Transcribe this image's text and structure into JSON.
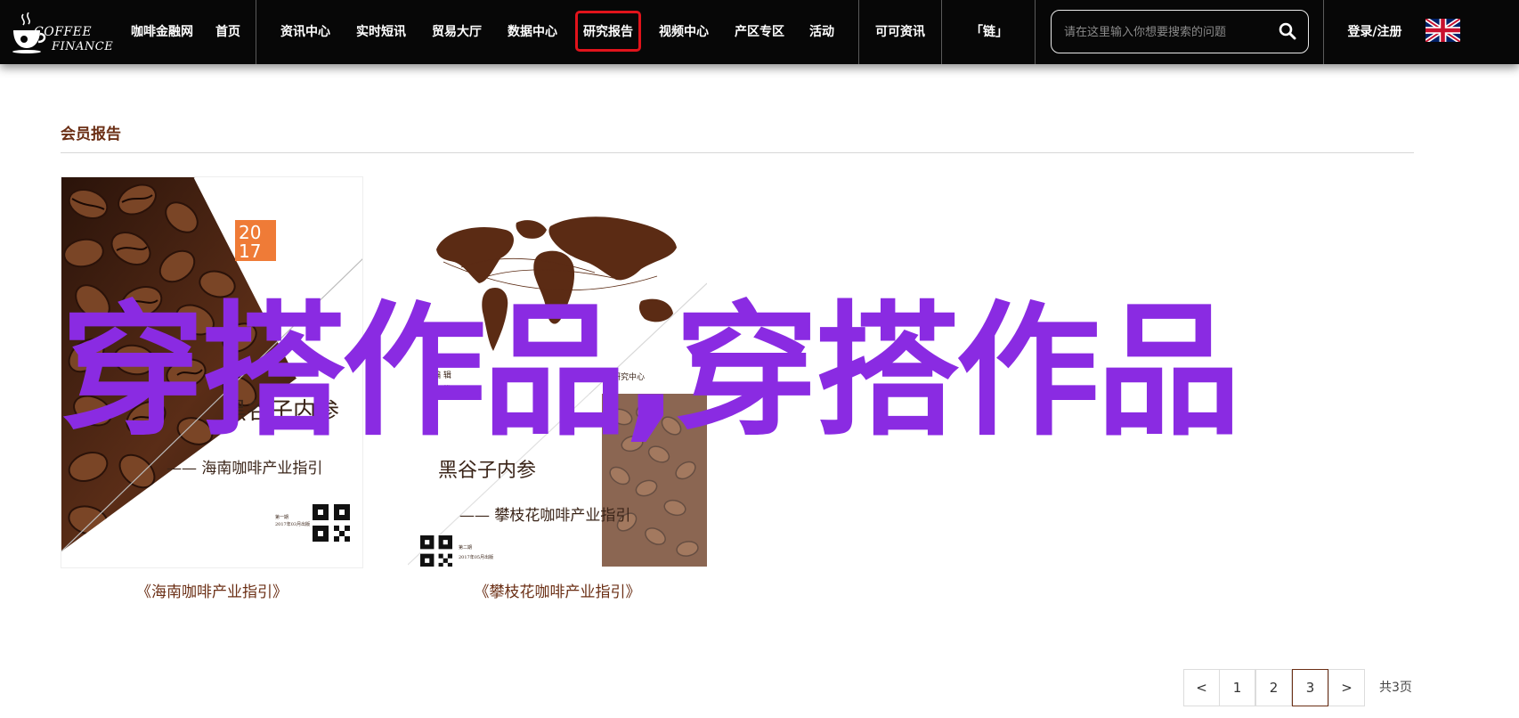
{
  "header": {
    "logo": {
      "line1": "COFFEE",
      "line2": "FINANCE"
    },
    "nav": [
      {
        "label": "咖啡金融网"
      },
      {
        "label": "首页"
      },
      {
        "label": "资讯中心"
      },
      {
        "label": "实时短讯"
      },
      {
        "label": "贸易大厅"
      },
      {
        "label": "数据中心"
      },
      {
        "label": "研究报告",
        "active": true
      },
      {
        "label": "视频中心"
      },
      {
        "label": "产区专区"
      },
      {
        "label": "活动"
      },
      {
        "label": "可可资讯"
      },
      {
        "label": "「链」"
      }
    ],
    "search": {
      "placeholder": "请在这里输入你想要搜索的问题"
    },
    "login_label": "登录/注册",
    "accent_color": "#e1131b"
  },
  "section": {
    "title": "会员报告"
  },
  "reports": [
    {
      "caption": "《海南咖啡产业指引》",
      "cover": {
        "year_top": "20",
        "year_bottom": "17",
        "title": "黑谷子内参",
        "subtitle": "—— 海南咖啡产业指引",
        "qr_note1": "第一期",
        "qr_note2": "2017年03月出版"
      }
    },
    {
      "caption": "《攀枝花咖啡产业指引》",
      "cover": {
        "line_a": "编  辑",
        "line_b": "海  拔",
        "line_c": "全球咖啡产业研究中心",
        "title": "黑谷子内参",
        "subtitle": "—— 攀枝花咖啡产业指引",
        "qr_note1": "第二期",
        "qr_note2": "2017年05月出版"
      }
    }
  ],
  "overlay_text": "穿搭作品,穿搭作品",
  "pagination": {
    "prev": "<",
    "pages": [
      "1",
      "2",
      "3"
    ],
    "current": "3",
    "next": ">",
    "total": "共3页"
  }
}
